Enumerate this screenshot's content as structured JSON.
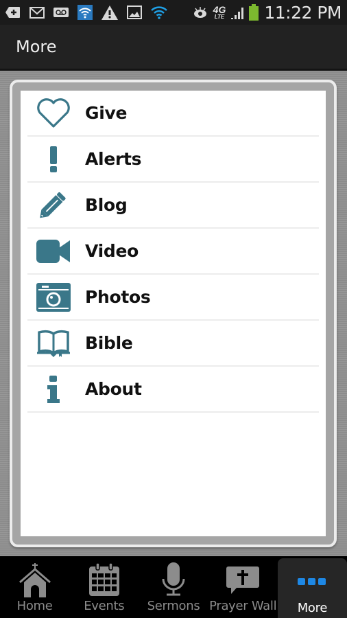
{
  "status_bar": {
    "left_icons": [
      "add-notification-icon",
      "gmail-icon",
      "voicemail-icon",
      "wifi-hotspot-icon",
      "warning-icon",
      "image-icon",
      "wifi-icon"
    ],
    "right_icons": [
      "eye-icon",
      "4g-lte-icon",
      "signal-icon",
      "battery-icon"
    ],
    "network_label": "4G",
    "network_sub": "LTE",
    "time": "11:22 PM"
  },
  "header": {
    "title": "More"
  },
  "colors": {
    "accent": "#3a7789",
    "tab_active_dots": "#1e88e5",
    "tab_inactive": "#8c8c8c"
  },
  "menu": {
    "items": [
      {
        "label": "Give",
        "icon": "heart-icon"
      },
      {
        "label": "Alerts",
        "icon": "exclamation-icon"
      },
      {
        "label": "Blog",
        "icon": "pencil-icon"
      },
      {
        "label": "Video",
        "icon": "video-camera-icon"
      },
      {
        "label": "Photos",
        "icon": "camera-icon"
      },
      {
        "label": "Bible",
        "icon": "book-icon"
      },
      {
        "label": "About",
        "icon": "info-icon"
      }
    ]
  },
  "tabbar": {
    "tabs": [
      {
        "label": "Home",
        "icon": "church-icon",
        "active": false
      },
      {
        "label": "Events",
        "icon": "calendar-icon",
        "active": false
      },
      {
        "label": "Sermons",
        "icon": "microphone-icon",
        "active": false
      },
      {
        "label": "Prayer Wall",
        "icon": "prayer-bubble-icon",
        "active": false
      },
      {
        "label": "More",
        "icon": "more-dots-icon",
        "active": true
      }
    ]
  }
}
